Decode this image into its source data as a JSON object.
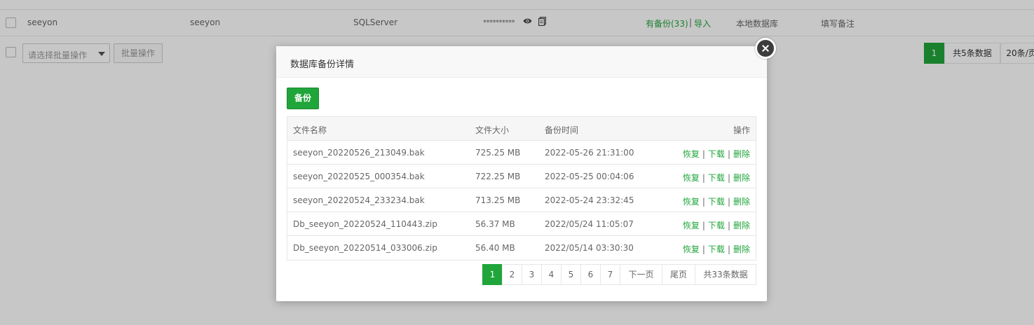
{
  "bg_row": {
    "name": "seeyon",
    "user": "seeyon",
    "dbtype": "SQLServer",
    "password_mask": "**********",
    "backup_link": "有备份(33)",
    "separator": "|",
    "import_link": "导入",
    "location": "本地数据库",
    "remark": "填写备注"
  },
  "bg_footer": {
    "batch_placeholder": "请选择批量操作",
    "batch_button": "批量操作",
    "current_page": "1",
    "total": "共5条数据",
    "per_page": "20条/页"
  },
  "modal": {
    "title": "数据库备份详情",
    "backup_button": "备份",
    "columns": [
      "文件名称",
      "文件大小",
      "备份时间",
      "操作"
    ],
    "actions": {
      "restore": "恢复",
      "download": "下载",
      "delete": "删除",
      "sep": "|"
    },
    "rows": [
      {
        "name": "seeyon_20220526_213049.bak",
        "size": "725.25 MB",
        "time": "2022-05-26 21:31:00"
      },
      {
        "name": "seeyon_20220525_000354.bak",
        "size": "722.25 MB",
        "time": "2022-05-25 00:04:06"
      },
      {
        "name": "seeyon_20220524_233234.bak",
        "size": "713.25 MB",
        "time": "2022-05-24 23:32:45"
      },
      {
        "name": "Db_seeyon_20220524_110443.zip",
        "size": "56.37 MB",
        "time": "2022/05/24 11:05:07"
      },
      {
        "name": "Db_seeyon_20220514_033006.zip",
        "size": "56.40 MB",
        "time": "2022/05/14 03:30:30"
      }
    ],
    "pager": {
      "pages": [
        "1",
        "2",
        "3",
        "4",
        "5",
        "6",
        "7"
      ],
      "next": "下一页",
      "last": "尾页",
      "total": "共33条数据"
    }
  },
  "colors": {
    "accent": "#20a53a",
    "close_bg": "#3d3d3d"
  }
}
